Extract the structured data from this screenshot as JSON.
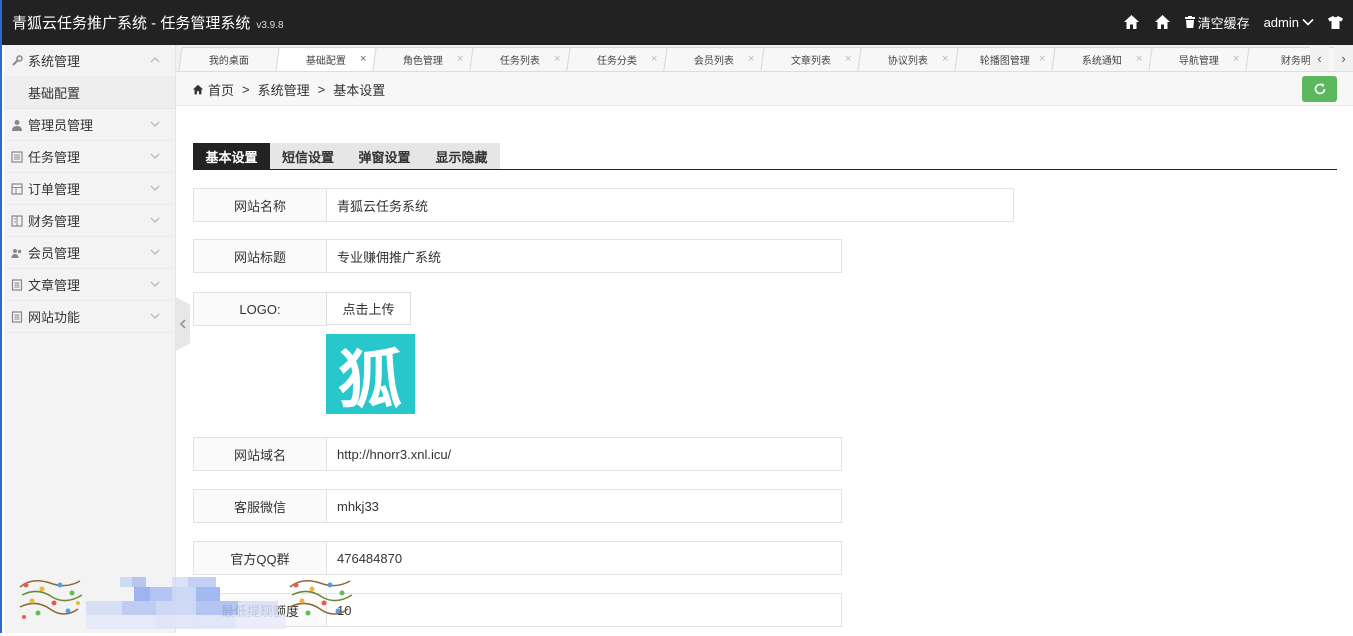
{
  "app": {
    "title": "青狐云任务推广系统 - 任务管理系统",
    "version": "v3.9.8"
  },
  "topbar": {
    "clear_cache_label": "清空缓存",
    "user_label": "admin"
  },
  "sidebar": {
    "items": [
      {
        "label": "系统管理",
        "icon": "wrench-icon",
        "expanded": true,
        "children": [
          {
            "label": "基础配置"
          }
        ]
      },
      {
        "label": "管理员管理",
        "icon": "user-icon",
        "expanded": false
      },
      {
        "label": "任务管理",
        "icon": "list-icon",
        "expanded": false
      },
      {
        "label": "订单管理",
        "icon": "table-icon",
        "expanded": false
      },
      {
        "label": "财务管理",
        "icon": "ledger-icon",
        "expanded": false
      },
      {
        "label": "会员管理",
        "icon": "users-icon",
        "expanded": false
      },
      {
        "label": "文章管理",
        "icon": "document-icon",
        "expanded": false
      },
      {
        "label": "网站功能",
        "icon": "document-icon",
        "expanded": false
      }
    ]
  },
  "tabs": [
    {
      "label": "我的桌面",
      "closable": false,
      "active": false
    },
    {
      "label": "基础配置",
      "closable": true,
      "active": true
    },
    {
      "label": "角色管理",
      "closable": true,
      "active": false
    },
    {
      "label": "任务列表",
      "closable": true,
      "active": false
    },
    {
      "label": "任务分类",
      "closable": true,
      "active": false
    },
    {
      "label": "会员列表",
      "closable": true,
      "active": false
    },
    {
      "label": "文章列表",
      "closable": true,
      "active": false
    },
    {
      "label": "协议列表",
      "closable": true,
      "active": false
    },
    {
      "label": "轮播图管理",
      "closable": true,
      "active": false
    },
    {
      "label": "系统通知",
      "closable": true,
      "active": false
    },
    {
      "label": "导航管理",
      "closable": true,
      "active": false
    },
    {
      "label": "财务明",
      "closable": false,
      "active": false
    }
  ],
  "breadcrumb": {
    "home": "首页",
    "level1": "系统管理",
    "level2": "基本设置",
    "separator": ">"
  },
  "subtabs": [
    "基本设置",
    "短信设置",
    "弹窗设置",
    "显示隐藏"
  ],
  "form": {
    "site_name": {
      "label": "网站名称",
      "value": "青狐云任务系统"
    },
    "site_title": {
      "label": "网站标题",
      "value": "专业赚佣推广系统"
    },
    "logo": {
      "label": "LOGO:",
      "button": "点击上传",
      "logo_char": "狐"
    },
    "site_domain": {
      "label": "网站域名",
      "value": "http://hnorr3.xnl.icu/"
    },
    "service_wechat": {
      "label": "客服微信",
      "value": "mhkj33"
    },
    "qq_group": {
      "label": "官方QQ群",
      "value": "476484870"
    },
    "withdraw": {
      "label": "最低提现额度",
      "value": "10"
    }
  },
  "colors": {
    "topbar": "#222222",
    "refresh": "#5cb85c",
    "logo_bg": "#28c7cc",
    "active_subtab": "#222222"
  }
}
